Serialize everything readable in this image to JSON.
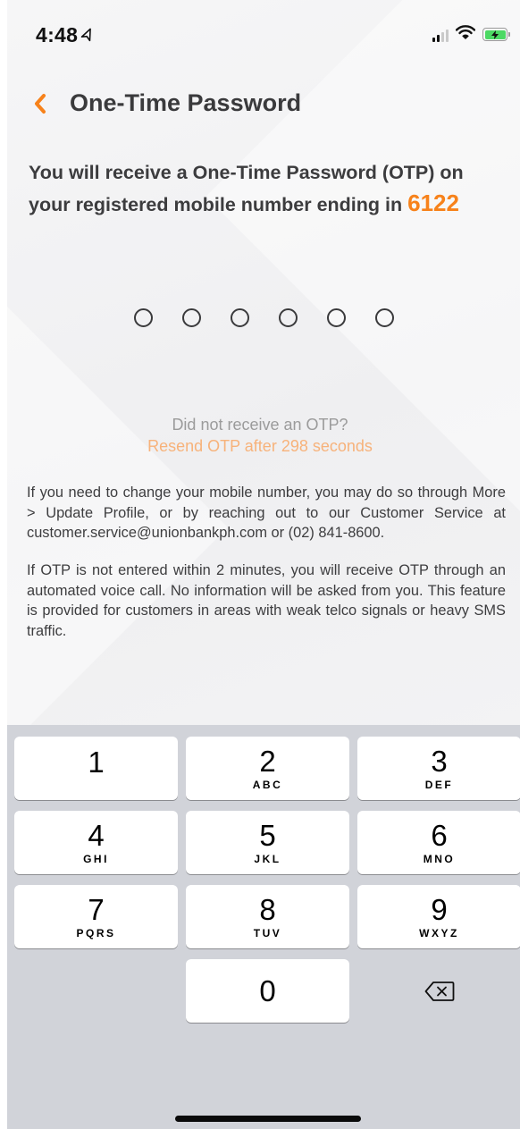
{
  "status_bar": {
    "time": "4:48",
    "location_icon": "location-arrow-icon",
    "signal_icon": "cellular-signal-icon",
    "wifi_icon": "wifi-icon",
    "battery_icon": "battery-charging-icon"
  },
  "header": {
    "back_icon": "chevron-left-icon",
    "title": "One-Time Password"
  },
  "intro": {
    "text": "You will receive a One-Time Password (OTP) on your registered mobile number ending in",
    "number_suffix": "6122"
  },
  "otp": {
    "length": 6,
    "filled": 0
  },
  "resend": {
    "question": "Did not receive an OTP?",
    "timer_text": "Resend OTP after 298 seconds"
  },
  "info": {
    "change_number": "If you need to change your mobile number, you may do so through More > Update Profile, or by reaching out to our Customer Service at customer.service@unionbankph.com or (02) 841-8600.",
    "voice_call": "If OTP is not entered within 2 minutes, you will receive OTP through an automated voice call. No information will be asked from you. This feature is provided for customers in areas with weak telco signals or heavy SMS traffic."
  },
  "keypad": {
    "keys": [
      {
        "digit": "1",
        "letters": ""
      },
      {
        "digit": "2",
        "letters": "ABC"
      },
      {
        "digit": "3",
        "letters": "DEF"
      },
      {
        "digit": "4",
        "letters": "GHI"
      },
      {
        "digit": "5",
        "letters": "JKL"
      },
      {
        "digit": "6",
        "letters": "MNO"
      },
      {
        "digit": "7",
        "letters": "PQRS"
      },
      {
        "digit": "8",
        "letters": "TUV"
      },
      {
        "digit": "9",
        "letters": "WXYZ"
      },
      {
        "digit": "0",
        "letters": ""
      }
    ],
    "delete_icon": "backspace-icon"
  },
  "colors": {
    "accent": "#f7821b",
    "accent_light": "#f7b27a",
    "text_dark": "#3c3c3e",
    "text_muted": "#9b9b9b",
    "keypad_bg": "#d1d3d9"
  }
}
